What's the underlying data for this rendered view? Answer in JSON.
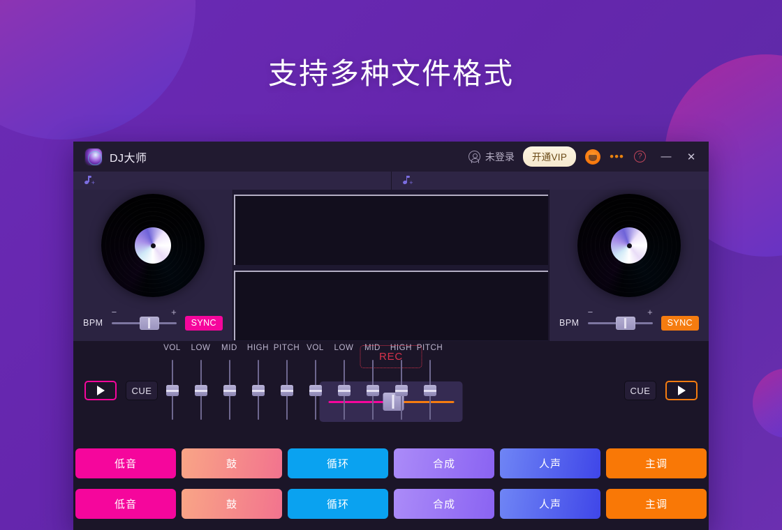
{
  "page": {
    "heading": "支持多种文件格式"
  },
  "titlebar": {
    "app_name": "DJ大师",
    "logo_icon": "dj-disc-logo",
    "account_icon": "user-circle-icon",
    "account_label": "未登录",
    "vip_label": "开通VIP",
    "headset_icon": "headset-icon",
    "more_icon": "more-dots-icon",
    "more_glyph": "•••",
    "help_icon": "question-circle-icon",
    "help_glyph": "?",
    "minimize_icon": "minimize-icon",
    "minimize_glyph": "—",
    "close_icon": "close-icon",
    "close_glyph": "✕"
  },
  "loadbars": [
    {
      "icon": "music-note-plus-icon",
      "plus": "+"
    },
    {
      "icon": "music-note-plus-icon",
      "plus": "+"
    }
  ],
  "decks": {
    "left": {
      "vinyl_icon": "vinyl-record",
      "bpm_label": "BPM",
      "minus": "−",
      "plus": "+",
      "sync_label": "SYNC",
      "sync_color": "#f5069c"
    },
    "right": {
      "vinyl_icon": "vinyl-record",
      "bpm_label": "BPM",
      "minus": "−",
      "plus": "+",
      "sync_label": "SYNC",
      "sync_color": "#f57c10"
    }
  },
  "mixer": {
    "fader_labels": [
      "VOL",
      "LOW",
      "MID",
      "HIGH",
      "PITCH"
    ],
    "left_play_label": "play-triangle",
    "left_cue_label": "CUE",
    "right_cue_label": "CUE",
    "right_play_label": "play-triangle",
    "rec_label": "REC",
    "rec_color": "#d9334b",
    "crossfader_left_color": "#f5069c",
    "crossfader_right_color": "#f57c10"
  },
  "pads": {
    "row1": [
      {
        "label": "低音",
        "color": "#f5069c"
      },
      {
        "label": "鼓",
        "color": "#f79279"
      },
      {
        "label": "循环",
        "color": "#0aa2f0"
      },
      {
        "label": "合成",
        "color": "#9c7bf5"
      },
      {
        "label": "人声",
        "color": "#5b6ef0"
      },
      {
        "label": "主调",
        "color": "#f97806"
      }
    ],
    "row2": [
      {
        "label": "低音",
        "color": "#f5069c"
      },
      {
        "label": "鼓",
        "color": "#f79279"
      },
      {
        "label": "循环",
        "color": "#0aa2f0"
      },
      {
        "label": "合成",
        "color": "#9c7bf5"
      },
      {
        "label": "人声",
        "color": "#5b6ef0"
      },
      {
        "label": "主调",
        "color": "#f97806"
      }
    ]
  }
}
